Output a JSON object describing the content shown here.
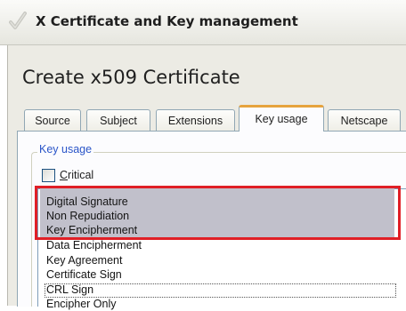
{
  "window": {
    "title": "X Certificate and Key management"
  },
  "dialog": {
    "title": "Create x509 Certificate"
  },
  "tabs": [
    {
      "label": "Source",
      "active": false
    },
    {
      "label": "Subject",
      "active": false
    },
    {
      "label": "Extensions",
      "active": false
    },
    {
      "label": "Key usage",
      "active": true
    },
    {
      "label": "Netscape",
      "active": false
    }
  ],
  "key_usage": {
    "group_label": "Key usage",
    "critical": {
      "label_first": "C",
      "label_rest": "ritical",
      "checked": false
    },
    "items": [
      {
        "label": "Digital Signature",
        "selected": true
      },
      {
        "label": "Non Repudiation",
        "selected": true
      },
      {
        "label": "Key Encipherment",
        "selected": true
      },
      {
        "label": "Data Encipherment",
        "selected": false
      },
      {
        "label": "Key Agreement",
        "selected": false
      },
      {
        "label": "Certificate Sign",
        "selected": false
      },
      {
        "label": "CRL Sign",
        "selected": false,
        "focused": true
      },
      {
        "label": "Encipher Only",
        "selected": false
      }
    ]
  },
  "colors": {
    "highlight_frame": "#e01f26",
    "selection": "#c1c0cb",
    "active_tab_accent": "#e6a33d",
    "group_label": "#2a55c8"
  }
}
